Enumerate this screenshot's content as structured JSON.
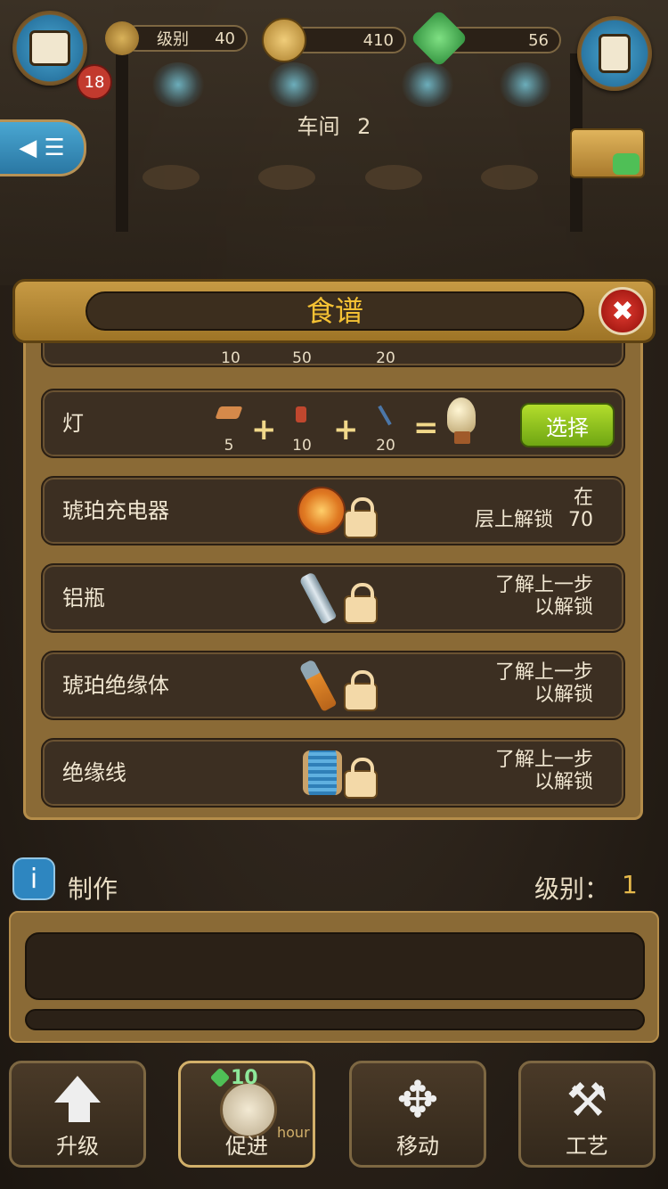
{
  "hud": {
    "tasks_count": "18",
    "level_label": "级别",
    "level_value": "40",
    "coins": "410",
    "gems": "56"
  },
  "room": {
    "label": "车间",
    "number": "2"
  },
  "recipe_panel": {
    "title": "食谱",
    "partial_row_numbers": [
      "10",
      "50",
      "20"
    ],
    "rows": [
      {
        "name": "灯",
        "ingredients": [
          "5",
          "10",
          "20"
        ],
        "button": "选择"
      },
      {
        "name": "琥珀充电器",
        "unlock_line1": "在",
        "unlock_line2": "层上解锁",
        "unlock_level": "70"
      },
      {
        "name": "铝瓶",
        "unlock_line1": "了解上一步",
        "unlock_line2": "以解锁"
      },
      {
        "name": "琥珀绝缘体",
        "unlock_line1": "了解上一步",
        "unlock_line2": "以解锁"
      },
      {
        "name": "绝缘线",
        "unlock_line1": "了解上一步",
        "unlock_line2": "以解锁"
      }
    ],
    "operators": {
      "plus": "+",
      "equals": "="
    }
  },
  "production": {
    "info": "i",
    "label": "制作",
    "level_label": "级别：",
    "level_value": "1"
  },
  "toolbar": {
    "upgrade": "升级",
    "boost": "促进",
    "boost_cost": "10",
    "boost_unit": "hour",
    "move": "移动",
    "craft": "工艺"
  },
  "colors": {
    "accent_gold": "#f5c234",
    "select_green": "#8ec41f",
    "close_red": "#d8302a",
    "hud_blue": "#2f8fc2"
  },
  "icons": [
    "toolbox-icon",
    "clipboard-icon",
    "gear-icon",
    "coin-icon",
    "gem-icon",
    "chest-icon",
    "back-menu-icon",
    "close-icon",
    "lock-icon",
    "info-icon",
    "arrow-up-icon",
    "compass-icon",
    "move-arrows-icon",
    "tools-icon"
  ]
}
